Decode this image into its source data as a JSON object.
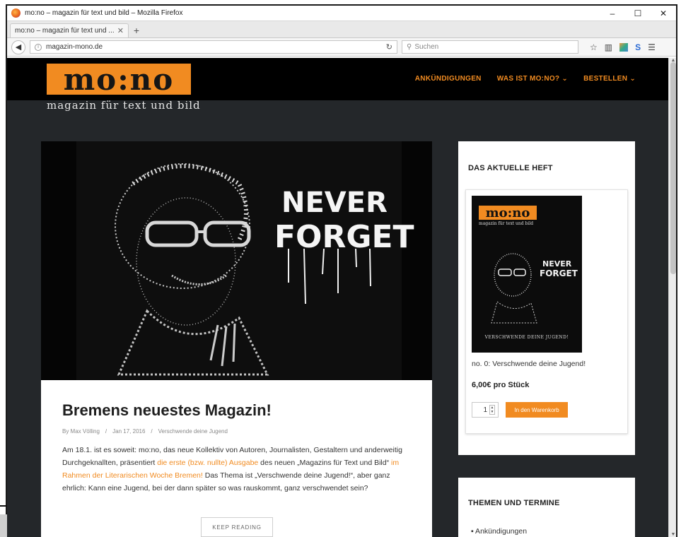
{
  "browser": {
    "window_title": "mo:no – magazin für text und bild – Mozilla Firefox",
    "tab_label": "mo:no – magazin für text und ...",
    "url": "magazin-mono.de",
    "search_placeholder": "Suchen",
    "controls": {
      "minimize": "–",
      "maximize": "☐",
      "close": "✕"
    }
  },
  "site": {
    "logo": "mo:no",
    "tagline": "magazin für text und bild",
    "nav": [
      {
        "label": "ANKÜNDIGUNGEN"
      },
      {
        "label": "WAS IST MO:NO? ⌄"
      },
      {
        "label": "BESTELLEN ⌄"
      }
    ],
    "accent_color": "#f18b21",
    "header_bg": "#000000",
    "page_bg": "#24272a"
  },
  "hero": {
    "graffiti_text_1": "NEVER",
    "graffiti_text_2": "FORGET"
  },
  "post": {
    "title": "Bremens neuestes Magazin!",
    "meta_author": "By Max Völling",
    "meta_sep": "/",
    "meta_date": "Jan 17, 2016",
    "meta_category": "Verschwende deine Jugend",
    "body_1": "Am 18.1. ist es soweit: mo:no, das neue Kollektiv von Autoren, Journalisten, Gestaltern und anderweitig Durchgeknallten, präsentiert ",
    "body_link_1": "die erste (bzw. nullte) Ausgabe",
    "body_2": " des neuen „Magazins für Text und Bild“ ",
    "body_link_2": "im Rahmen der Literarischen Woche Bremen!",
    "body_3": " Das Thema ist „Verschwende deine Jugend!“, aber ganz ehrlich: Kann eine Jugend, bei der dann später so was rauskommt, ganz verschwendet sein?",
    "read_more": "KEEP READING"
  },
  "sidebar": {
    "widget_1_title": "DAS AKTUELLE HEFT",
    "cover_logo": "mo:no",
    "cover_tagline": "magazin für text und bild",
    "cover_never": "NEVER",
    "cover_forget": "FORGET",
    "cover_footer": "VERSCHWENDE DEINE JUGEND!",
    "product_name": "no. 0: Verschwende deine Jugend!",
    "product_price": "6,00€ pro Stück",
    "quantity": "1",
    "add_to_cart": "In den Warenkorb",
    "widget_2_title": "THEMEN UND TERMINE",
    "list_item_1": "▪ Ankündigungen"
  }
}
